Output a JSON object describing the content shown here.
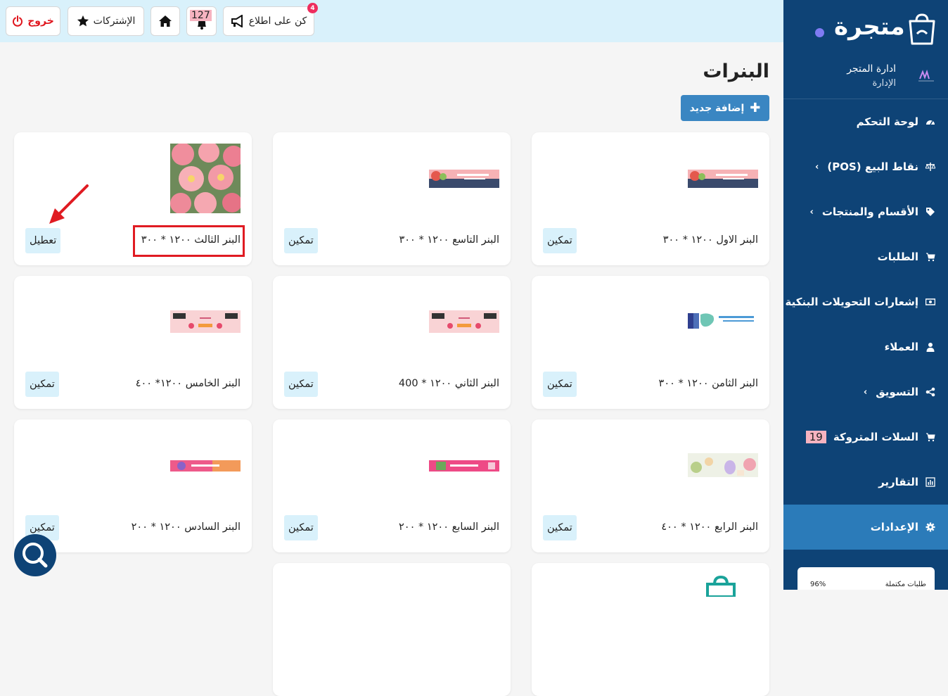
{
  "topbar": {
    "logout_label": "خروج",
    "subscriptions_label": "الإشتركات",
    "notifications_count": "127",
    "stay_informed_label": "كن على اطلاع",
    "stay_informed_badge": "4"
  },
  "sidebar": {
    "logo_text": "متجرة",
    "store_name": "ادارة المتجر",
    "store_role": "الإدارة",
    "items": [
      {
        "label": "لوحة التحكم",
        "icon": "dashboard-icon"
      },
      {
        "label": "نقاط البيع (POS)",
        "icon": "scale-icon",
        "chevron": "›"
      },
      {
        "label": "الأقسام والمنتجات",
        "icon": "tag-icon",
        "chevron": "›"
      },
      {
        "label": "الطلبات",
        "icon": "cart-icon"
      },
      {
        "label": "إشعارات التحويلات البنكية",
        "icon": "money-icon"
      },
      {
        "label": "العملاء",
        "icon": "user-icon"
      },
      {
        "label": "التسويق",
        "icon": "share-icon",
        "chevron": "›"
      },
      {
        "label": "السلات المتروكة",
        "icon": "cart-icon",
        "count": "19"
      },
      {
        "label": "التقارير",
        "icon": "chart-icon"
      },
      {
        "label": "الإعدادات",
        "icon": "gear-icon",
        "active": true
      }
    ],
    "stats_card": {
      "label": "طلبات مكتملة",
      "value": "96%"
    }
  },
  "main": {
    "title": "البنرات",
    "add_button": "إضافة جديد",
    "cards": [
      {
        "title": "البنر الاول ١٢٠٠ * ٣٠٠",
        "button": "تمكين"
      },
      {
        "title": "البنر التاسع ١٢٠٠ * ٣٠٠",
        "button": "تمكين"
      },
      {
        "title": "البنر الثالث ١٢٠٠ * ٣٠٠",
        "button": "تعطيل"
      },
      {
        "title": "البنر الثامن ١٢٠٠ * ٣٠٠",
        "button": "تمكين"
      },
      {
        "title": "البنر الثاني ١٢٠٠ * 400",
        "button": "تمكين"
      },
      {
        "title": "البنر الخامس ١٢٠٠* ٤٠٠",
        "button": "تمكين"
      },
      {
        "title": "البنر الرابع ١٢٠٠ * ٤٠٠",
        "button": "تمكين"
      },
      {
        "title": "البنر السابع ١٢٠٠ * ٢٠٠",
        "button": "تمكين"
      },
      {
        "title": "البنر السادس ١٢٠٠ * ٢٠٠",
        "button": "تمكين"
      }
    ]
  },
  "colors": {
    "sidebar_bg": "#0e4376",
    "sidebar_active": "#2b7bb9",
    "topbar_bg": "#d9f1fb",
    "accent": "#3a86c2",
    "danger": "#e01b22"
  }
}
